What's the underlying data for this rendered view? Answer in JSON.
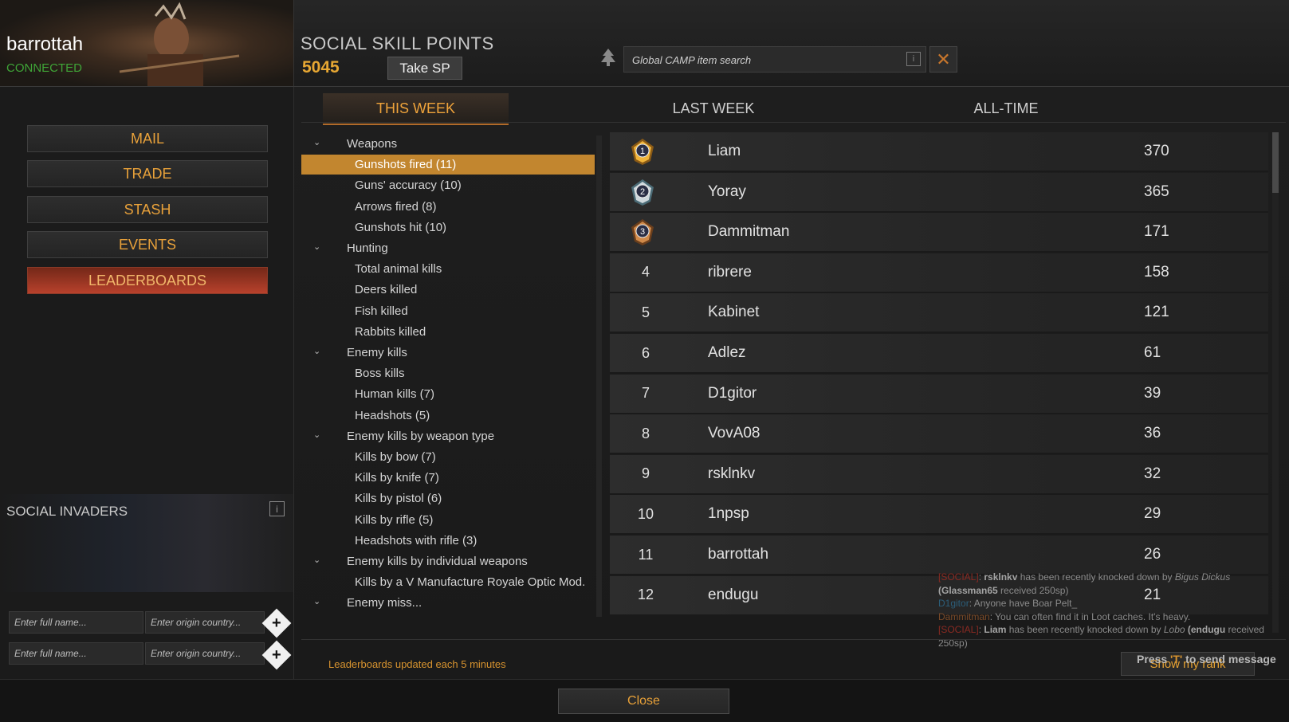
{
  "player": {
    "name": "barrottah",
    "status": "CONNECTED"
  },
  "ssp": {
    "title": "SOCIAL SKILL POINTS",
    "value": "5045",
    "take_label": "Take SP"
  },
  "search": {
    "placeholder": "Global CAMP item search",
    "info": "i"
  },
  "nav": [
    {
      "label": "MAIL",
      "active": false
    },
    {
      "label": "TRADE",
      "active": false
    },
    {
      "label": "STASH",
      "active": false
    },
    {
      "label": "EVENTS",
      "active": false
    },
    {
      "label": "LEADERBOARDS",
      "active": true
    }
  ],
  "invaders": {
    "title": "SOCIAL INVADERS",
    "info": "i",
    "name_placeholder": "Enter full name...",
    "country_placeholder": "Enter origin country..."
  },
  "tabs": [
    {
      "label": "THIS WEEK",
      "active": true
    },
    {
      "label": "LAST WEEK",
      "active": false
    },
    {
      "label": "ALL-TIME",
      "active": false
    }
  ],
  "tree": [
    {
      "type": "group",
      "label": "Weapons"
    },
    {
      "type": "item",
      "label": "Gunshots fired (11)",
      "selected": true
    },
    {
      "type": "item",
      "label": "Guns' accuracy (10)"
    },
    {
      "type": "item",
      "label": "Arrows fired (8)"
    },
    {
      "type": "item",
      "label": "Gunshots hit (10)"
    },
    {
      "type": "group",
      "label": "Hunting"
    },
    {
      "type": "item",
      "label": "Total animal kills"
    },
    {
      "type": "item",
      "label": "Deers killed"
    },
    {
      "type": "item",
      "label": "Fish killed"
    },
    {
      "type": "item",
      "label": "Rabbits killed"
    },
    {
      "type": "group",
      "label": "Enemy kills"
    },
    {
      "type": "item",
      "label": "Boss kills"
    },
    {
      "type": "item",
      "label": "Human kills (7)"
    },
    {
      "type": "item",
      "label": "Headshots (5)"
    },
    {
      "type": "group",
      "label": "Enemy kills by weapon type"
    },
    {
      "type": "item",
      "label": "Kills by bow (7)"
    },
    {
      "type": "item",
      "label": "Kills by knife (7)"
    },
    {
      "type": "item",
      "label": "Kills by pistol (6)"
    },
    {
      "type": "item",
      "label": "Kills by rifle (5)"
    },
    {
      "type": "item",
      "label": "Headshots with rifle (3)"
    },
    {
      "type": "group",
      "label": "Enemy kills by individual weapons"
    },
    {
      "type": "item",
      "label": "Kills by a V Manufacture Royale Optic Mod."
    },
    {
      "type": "group",
      "label": "Enemy miss..."
    }
  ],
  "leaderboard": [
    {
      "rank": "1",
      "name": "Liam",
      "score": "370",
      "medal": "gold"
    },
    {
      "rank": "2",
      "name": "Yoray",
      "score": "365",
      "medal": "silver"
    },
    {
      "rank": "3",
      "name": "Dammitman",
      "score": "171",
      "medal": "bronze"
    },
    {
      "rank": "4",
      "name": "ribrere",
      "score": "158"
    },
    {
      "rank": "5",
      "name": "Kabinet",
      "score": "121"
    },
    {
      "rank": "6",
      "name": "Adlez",
      "score": "61"
    },
    {
      "rank": "7",
      "name": "D1gitor",
      "score": "39"
    },
    {
      "rank": "8",
      "name": "VovA08",
      "score": "36"
    },
    {
      "rank": "9",
      "name": "rsklnkv",
      "score": "32"
    },
    {
      "rank": "10",
      "name": "1npsp",
      "score": "29"
    },
    {
      "rank": "11",
      "name": "barrottah",
      "score": "26"
    },
    {
      "rank": "12",
      "name": "endugu",
      "score": "21"
    }
  ],
  "chat": {
    "tag": "[SOCIAL]",
    "l1_user": "rsklnkv",
    "l1_text": " has been recently knocked down by ",
    "l1_by": "Bigus Dickus",
    "l2": "(Glassman65",
    "l2b": " received 250sp)",
    "l3_user": "D1gitor",
    "l3_text": ": Anyone have Boar Pelt_",
    "l4_user": "Dammitman",
    "l4_text": ": You can often find it in Loot caches. It's heavy.",
    "l5_user": "Liam",
    "l5_text": " has been recently knocked down by ",
    "l5_by": "Lobo",
    "l5_rec": "(endugu",
    "l5_rec2": " received 250sp)",
    "press_pre": "Press ",
    "press_key": "'T'",
    "press_post": " to send message"
  },
  "footer": {
    "update_note": "Leaderboards updated each 5 minutes",
    "show_rank": "Show my rank",
    "close": "Close"
  },
  "colors": {
    "accent": "#e7a733",
    "selected": "#c2862f",
    "active_nav": "#b8412c",
    "connected": "#3fa437"
  },
  "icons": {
    "search_logo": "camp-tree-icon",
    "clear": "close-icon",
    "add": "plus-diamond-icon",
    "chevron": "chevron-down-icon"
  }
}
